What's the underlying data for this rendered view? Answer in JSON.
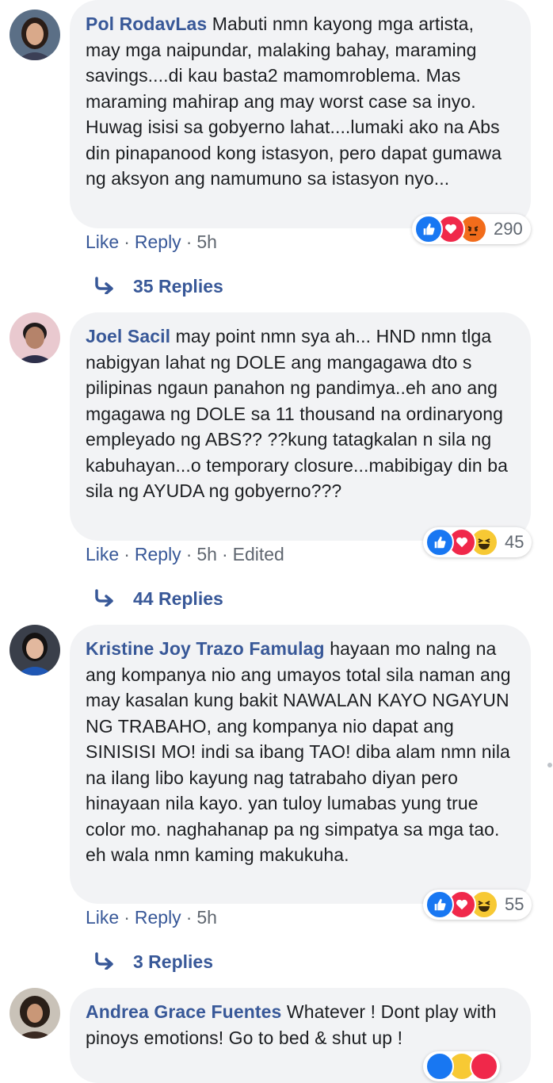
{
  "comments": [
    {
      "author": "Pol RodavLas",
      "text": "Mabuti nmn kayong mga artista, may mga naipundar, malaking bahay, maraming savings....di kau basta2 mamomroblema. Mas maraming mahirap ang may worst case sa inyo. Huwag isisi sa gobyerno lahat....lumaki ako na Abs din pinapanood kong istasyon, pero dapat gumawa ng aksyon ang namumuno sa istasyon nyo...",
      "like": "Like",
      "reply": "Reply",
      "time": "5h",
      "reaction_count": "290",
      "reaction_icons": [
        "like-icon",
        "love-icon",
        "angry-icon"
      ],
      "replies_label": "35 Replies"
    },
    {
      "author": "Joel Sacil",
      "text": "may point nmn sya ah... HND nmn tlga nabigyan lahat ng DOLE ang mangagawa dto s pilipinas ngaun panahon ng pandimya..eh ano ang mgagawa ng DOLE sa 11 thousand na ordinaryong empleyado ng ABS?? ??kung tatagkalan n sila ng kabuhayan...o temporary closure...mabibigay din ba sila ng AYUDA ng gobyerno???",
      "like": "Like",
      "reply": "Reply",
      "time": "5h",
      "edited": "Edited",
      "reaction_count": "45",
      "reaction_icons": [
        "like-icon",
        "love-icon",
        "haha-icon"
      ],
      "replies_label": "44 Replies"
    },
    {
      "author": "Kristine Joy Trazo Famulag",
      "text": "hayaan mo nalng na ang kompanya nio ang umayos total sila naman ang may kasalan kung bakit NAWALAN KAYO NGAYUN NG TRABAHO, ang kompanya nio dapat ang SINISISI MO! indi sa ibang TAO! diba alam nmn nila na ilang libo kayung nag tatrabaho diyan pero hinayaan nila kayo. yan tuloy lumabas yung true color mo. naghahanap pa ng simpatya sa mga tao. eh wala nmn kaming makukuha.",
      "like": "Like",
      "reply": "Reply",
      "time": "5h",
      "reaction_count": "55",
      "reaction_icons": [
        "like-icon",
        "love-icon",
        "haha-icon"
      ],
      "replies_label": "3 Replies"
    },
    {
      "author": "Andrea Grace Fuentes",
      "text": "Whatever ! Dont play with pinoys emotions! Go to bed & shut up !"
    }
  ],
  "colors": {
    "author": "#385898",
    "bubble": "#f2f3f5",
    "meta": "#606770",
    "like": "#1877f2",
    "love": "#f0284a",
    "angry": "#f26c1b",
    "haha": "#f7c934"
  }
}
